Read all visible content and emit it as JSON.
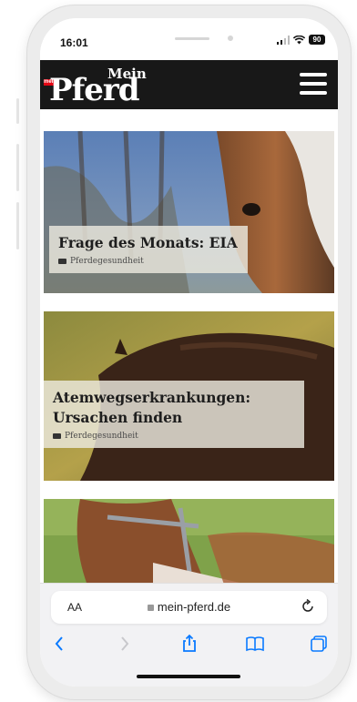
{
  "status_bar": {
    "time": "16:01",
    "battery": "90"
  },
  "site": {
    "logo_small": "Mein",
    "logo_main": "Pferd",
    "logo_badge": "mein"
  },
  "articles": [
    {
      "title": "Frage des Monats: EIA",
      "category": "Pferdegesundheit"
    },
    {
      "title": "Atemwegserkrankungen: Ursachen finden",
      "category": "Pferdegesundheit"
    },
    {
      "title": "",
      "category": ""
    }
  ],
  "browser": {
    "text_size_label": "AA",
    "url": "mein-pferd.de"
  },
  "colors": {
    "header_bg": "#181818",
    "browser_bg": "#f2f2f4",
    "caption_bg": "#ece9de",
    "ios_blue": "#0a7aff"
  },
  "icons": [
    "signal-icon",
    "wifi-icon",
    "battery-icon",
    "menu-icon",
    "folder-icon",
    "lock-icon",
    "reload-icon",
    "back-icon",
    "share-icon",
    "bookmarks-icon",
    "tabs-icon"
  ]
}
